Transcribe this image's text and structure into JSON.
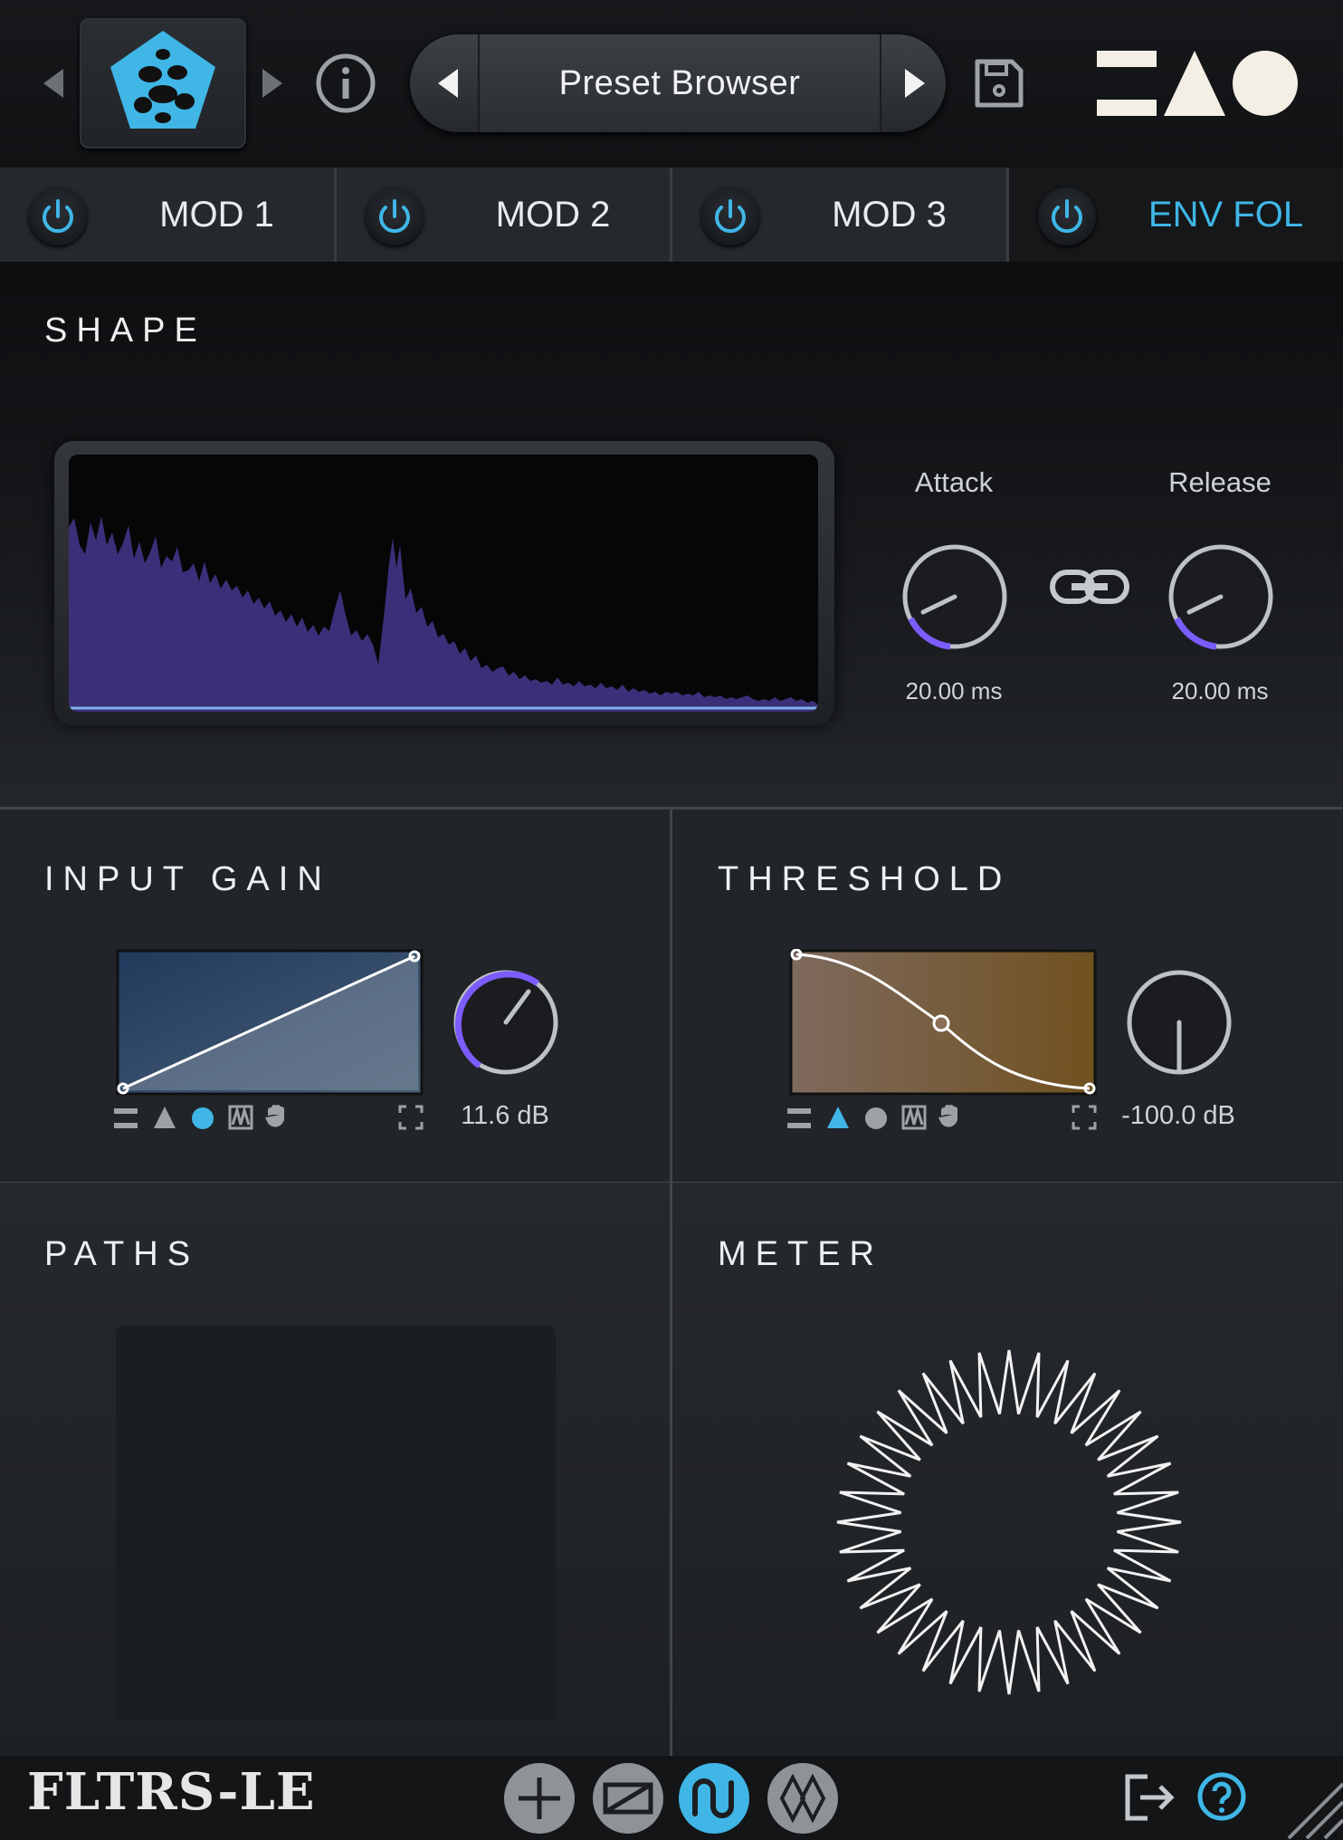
{
  "header": {
    "preset_label": "Preset Browser",
    "icons": {
      "prev": "triangle-left-icon",
      "next": "triangle-right-icon",
      "logo": "pentagon-logo-icon",
      "info": "info-icon",
      "save": "floppy-disk-icon",
      "brand": "brand-shapes-logo"
    }
  },
  "tabs": [
    {
      "label": "MOD 1",
      "active": false
    },
    {
      "label": "MOD 2",
      "active": false
    },
    {
      "label": "MOD 3",
      "active": false
    },
    {
      "label": "ENV FOL",
      "active": true
    }
  ],
  "shape": {
    "title": "SHAPE",
    "attack": {
      "label": "Attack",
      "value": "20.00 ms"
    },
    "release": {
      "label": "Release",
      "value": "20.00 ms"
    }
  },
  "input_gain": {
    "title": "INPUT GAIN",
    "value": "11.6 dB",
    "knob_fraction": 0.9,
    "selected_mode": "circle"
  },
  "threshold": {
    "title": "THRESHOLD",
    "value": "-100.0 dB",
    "knob_fraction": 0.0,
    "selected_mode": "triangle"
  },
  "paths": {
    "title": "PATHS"
  },
  "meter": {
    "title": "METER"
  },
  "footer": {
    "app_name": "FLTRS-LE",
    "buttons": [
      "plus-icon",
      "box-icon",
      "wave-icon",
      "diamond-link-icon"
    ],
    "active_button": "wave-icon"
  },
  "colors": {
    "accent": "#3fb6e6",
    "knob_arc": "#7b5cff",
    "spectrum": "#4a3a8e",
    "threshold_fill": "#7a5a2e"
  }
}
